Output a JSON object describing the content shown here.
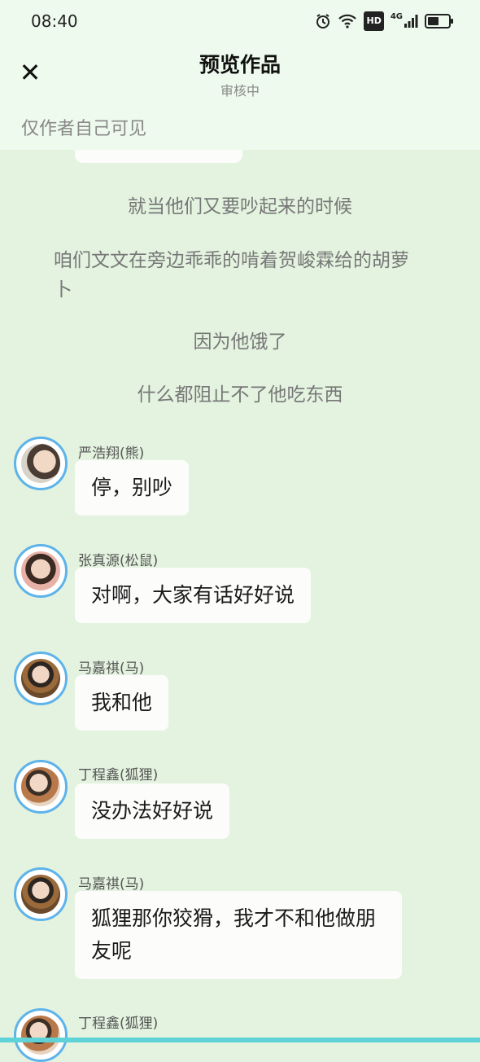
{
  "status": {
    "time": "08:40",
    "hd": "HD",
    "network": "4G",
    "icons": [
      "alarm-icon",
      "wifi-icon",
      "hd-icon",
      "signal-icon",
      "battery-icon"
    ]
  },
  "header": {
    "close_symbol": "✕",
    "title": "预览作品",
    "subtitle": "审核中",
    "visibility": "仅作者自己可见"
  },
  "narration": [
    "就当他们又要吵起来的时候",
    "咱们文文在旁边乖乖的啃着贺峻霖给的胡萝卜",
    "因为他饿了",
    "什么都阻止不了他吃东西"
  ],
  "messages": [
    {
      "name": "严浩翔(熊)",
      "text": "停，别吵"
    },
    {
      "name": "张真源(松鼠)",
      "text": "对啊，大家有话好好说"
    },
    {
      "name": "马嘉祺(马)",
      "text": "我和他"
    },
    {
      "name": "丁程鑫(狐狸)",
      "text": "没办法好好说"
    },
    {
      "name": "马嘉祺(马)",
      "text": "狐狸那你狡猾，我才不和他做朋友呢"
    },
    {
      "name": "丁程鑫(狐狸)",
      "text": ""
    }
  ],
  "colors": {
    "background": "#e3f3df",
    "header_bg": "#eefaed",
    "avatar_border": "#5db3ea",
    "bubble": "#fcfdfb"
  }
}
